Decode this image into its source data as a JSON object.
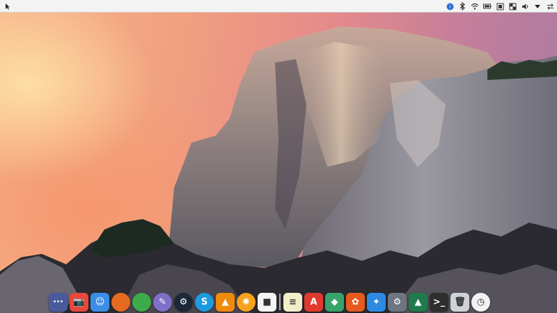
{
  "panel": {
    "menu_icon": "application-menu-icon",
    "tray_icons": [
      {
        "name": "notification-icon",
        "color": "#2a6fd6"
      },
      {
        "name": "bluetooth-icon",
        "color": "#333333"
      },
      {
        "name": "wifi-icon",
        "color": "#333333"
      },
      {
        "name": "battery-icon",
        "color": "#333333"
      },
      {
        "name": "clipboard-icon",
        "color": "#333333"
      },
      {
        "name": "display-icon",
        "color": "#333333"
      },
      {
        "name": "volume-icon",
        "color": "#333333"
      },
      {
        "name": "dropdown-arrow-icon",
        "color": "#333333"
      },
      {
        "name": "switch-icon",
        "color": "#333333"
      }
    ]
  },
  "dock": {
    "apps": [
      {
        "name": "show-apps-icon",
        "glyph": "···",
        "bg": "#4a5a9c"
      },
      {
        "name": "screenshot-icon",
        "glyph": "📷",
        "bg": "#e8483c"
      },
      {
        "name": "finder-icon",
        "glyph": "☺",
        "bg": "#3a8ee6"
      },
      {
        "name": "firefox-icon",
        "glyph": "",
        "bg": "#e66a1f"
      },
      {
        "name": "chrome-icon",
        "glyph": "",
        "bg": "#3cab4c"
      },
      {
        "name": "cursor-tool-icon",
        "glyph": "✎",
        "bg": "#7e6fc7"
      },
      {
        "name": "steam-icon",
        "glyph": "⚙",
        "bg": "#1b2838"
      },
      {
        "name": "skype-icon",
        "glyph": "S",
        "bg": "#1e9be0"
      },
      {
        "name": "vlc-icon",
        "glyph": "▲",
        "bg": "#f08a0c"
      },
      {
        "name": "orange-app-icon",
        "glyph": "✺",
        "bg": "#f7a21c"
      },
      {
        "name": "window-icon",
        "glyph": "■",
        "bg": "#f4f4f4"
      },
      {
        "name": "notes-icon",
        "glyph": "≡",
        "bg": "#f1eec8"
      },
      {
        "name": "pdf-reader-icon",
        "glyph": "A",
        "bg": "#e03a2f"
      },
      {
        "name": "maps-icon",
        "glyph": "◆",
        "bg": "#37a36a"
      },
      {
        "name": "paint-icon",
        "glyph": "✿",
        "bg": "#e65a1e"
      },
      {
        "name": "app-store-icon",
        "glyph": "✦",
        "bg": "#2d8ae0"
      },
      {
        "name": "system-settings-icon",
        "glyph": "⚙",
        "bg": "#6c7580"
      },
      {
        "name": "system-monitor-icon",
        "glyph": "▲",
        "bg": "#1f7a4c"
      },
      {
        "name": "terminal-icon",
        "glyph": ">_",
        "bg": "#2e2e2e"
      },
      {
        "name": "trash-icon",
        "glyph": "🗑",
        "bg": "#cfd3d6"
      },
      {
        "name": "clock-icon",
        "glyph": "◷",
        "bg": "#f2f2f2"
      }
    ]
  }
}
